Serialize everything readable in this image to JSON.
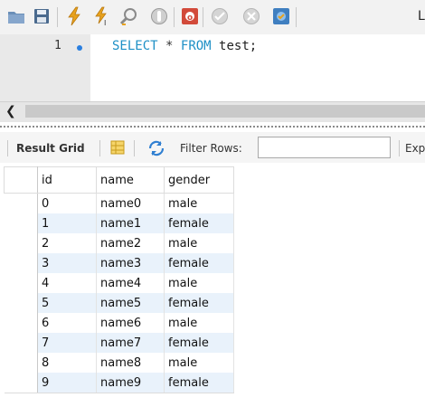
{
  "toolbar": {
    "buttons": [
      {
        "name": "open-folder-icon",
        "color": "#6b8fb8"
      },
      {
        "name": "save-icon",
        "color": "#4a6a8e"
      },
      {
        "name": "execute-lightning-icon",
        "color": "#e8a21d"
      },
      {
        "name": "execute-current-icon",
        "color": "#e8a21d"
      },
      {
        "name": "explain-magnifier-icon",
        "color": "#8a8a8a"
      },
      {
        "name": "stop-icon",
        "color": "#9a9a9a"
      },
      {
        "name": "toggle-error-icon",
        "color": "#d24a3a"
      },
      {
        "name": "commit-check-icon",
        "color": "#b5b5b5"
      },
      {
        "name": "rollback-x-icon",
        "color": "#b5b5b5"
      },
      {
        "name": "autocommit-icon",
        "color": "#3f7fc0"
      }
    ],
    "clipped_label": "L"
  },
  "editor": {
    "line_number": "1",
    "code": {
      "kw1": "SELECT",
      "star": "*",
      "kw2": "FROM",
      "table": "test;"
    }
  },
  "result_toolbar": {
    "result_grid_label": "Result Grid",
    "filter_label": "Filter Rows:",
    "filter_value": "",
    "export_label": "Exp"
  },
  "grid": {
    "columns": [
      "id",
      "name",
      "gender"
    ],
    "rows": [
      [
        "0",
        "name0",
        "male"
      ],
      [
        "1",
        "name1",
        "female"
      ],
      [
        "2",
        "name2",
        "male"
      ],
      [
        "3",
        "name3",
        "female"
      ],
      [
        "4",
        "name4",
        "male"
      ],
      [
        "5",
        "name5",
        "female"
      ],
      [
        "6",
        "name6",
        "male"
      ],
      [
        "7",
        "name7",
        "female"
      ],
      [
        "8",
        "name8",
        "male"
      ],
      [
        "9",
        "name9",
        "female"
      ]
    ]
  },
  "colors": {
    "keyword": "#1e90c6",
    "alt_row": "#e9f2fb",
    "gutter": "#e9e9e9"
  }
}
